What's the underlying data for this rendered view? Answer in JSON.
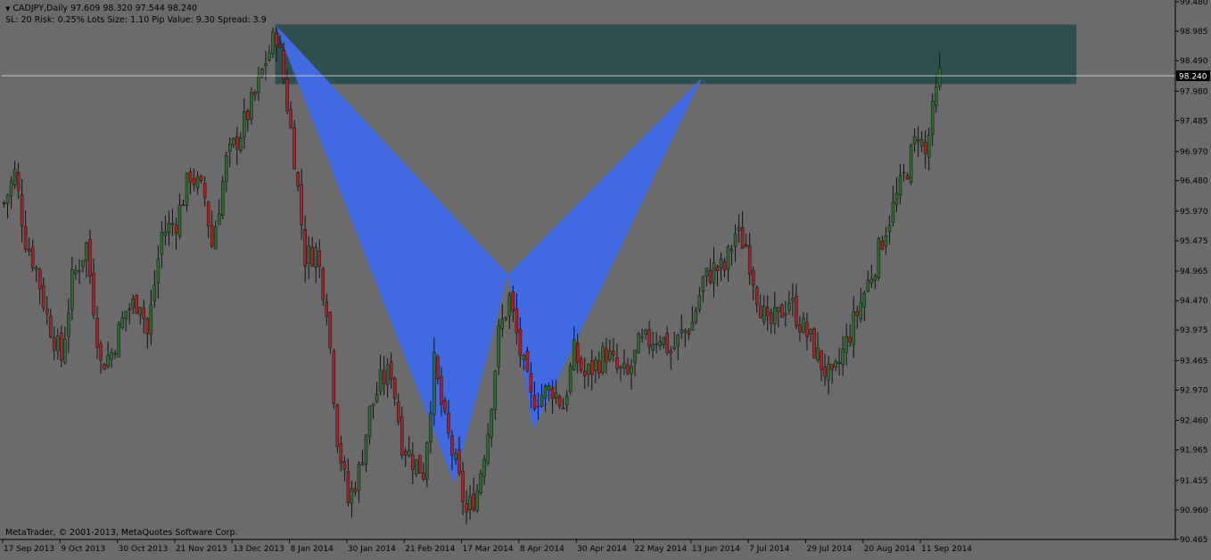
{
  "window": {
    "symbol_line": "CADJPY,Daily  97.609 98.320 97.544 98.240",
    "info_line": "SL: 20 Risk: 0.25%  Lots Size: 1.10 Pip Value: 9.30 Spread: 3.9",
    "copyright": "MetaTrader, © 2001-2013, MetaQuotes Software Corp."
  },
  "colors": {
    "background": "#6b6b6b",
    "axis": "#000000",
    "bull_candle": "#2e6b2e",
    "bear_candle": "#b02020",
    "pattern_fill": "#4169e1",
    "zone_fill": "#2f4f4f",
    "price_line": "#c0c0c0",
    "price_label_bg": "#000000",
    "price_label_text": "#ffffff"
  },
  "chart_data": {
    "type": "candlestick",
    "symbol": "CADJPY",
    "timeframe": "Daily",
    "ylim": [
      90.465,
      99.48
    ],
    "y_ticks": [
      "99.480",
      "98.985",
      "98.490",
      "97.980",
      "97.485",
      "96.970",
      "96.480",
      "95.970",
      "95.475",
      "94.965",
      "94.470",
      "93.975",
      "93.465",
      "92.970",
      "92.460",
      "91.965",
      "91.455",
      "90.960",
      "90.465"
    ],
    "x_tick_labels": [
      "17 Sep 2013",
      "9 Oct 2013",
      "30 Oct 2013",
      "21 Nov 2013",
      "13 Dec 2013",
      "8 Jan 2014",
      "30 Jan 2014",
      "21 Feb 2014",
      "17 Mar 2014",
      "8 Apr 2014",
      "30 Apr 2014",
      "22 May 2014",
      "13 Jun 2014",
      "7 Jul 2014",
      "29 Jul 2014",
      "20 Aug 2014",
      "11 Sep 2014"
    ],
    "last_price": "98.240",
    "close_path": [
      {
        "bar": 0,
        "price": 96.1
      },
      {
        "bar": 3,
        "price": 96.6
      },
      {
        "bar": 6,
        "price": 95.5
      },
      {
        "bar": 9,
        "price": 95.0
      },
      {
        "bar": 12,
        "price": 94.2
      },
      {
        "bar": 16,
        "price": 93.5
      },
      {
        "bar": 19,
        "price": 94.8
      },
      {
        "bar": 23,
        "price": 95.4
      },
      {
        "bar": 27,
        "price": 93.4
      },
      {
        "bar": 30,
        "price": 93.6
      },
      {
        "bar": 34,
        "price": 94.3
      },
      {
        "bar": 38,
        "price": 94.5
      },
      {
        "bar": 40,
        "price": 93.9
      },
      {
        "bar": 44,
        "price": 95.6
      },
      {
        "bar": 48,
        "price": 95.8
      },
      {
        "bar": 52,
        "price": 96.6
      },
      {
        "bar": 56,
        "price": 96.2
      },
      {
        "bar": 58,
        "price": 95.4
      },
      {
        "bar": 62,
        "price": 96.8
      },
      {
        "bar": 66,
        "price": 97.3
      },
      {
        "bar": 70,
        "price": 97.9
      },
      {
        "bar": 73,
        "price": 98.5
      },
      {
        "bar": 76,
        "price": 98.95
      },
      {
        "bar": 78,
        "price": 98.2
      },
      {
        "bar": 81,
        "price": 96.9
      },
      {
        "bar": 84,
        "price": 95.2
      },
      {
        "bar": 87,
        "price": 95.3
      },
      {
        "bar": 90,
        "price": 94.4
      },
      {
        "bar": 93,
        "price": 92.2
      },
      {
        "bar": 96,
        "price": 91.1
      },
      {
        "bar": 99,
        "price": 91.6
      },
      {
        "bar": 102,
        "price": 92.6
      },
      {
        "bar": 105,
        "price": 93.1
      },
      {
        "bar": 108,
        "price": 93.3
      },
      {
        "bar": 111,
        "price": 92.1
      },
      {
        "bar": 114,
        "price": 91.8
      },
      {
        "bar": 117,
        "price": 91.6
      },
      {
        "bar": 120,
        "price": 93.4
      },
      {
        "bar": 123,
        "price": 92.4
      },
      {
        "bar": 126,
        "price": 91.7
      },
      {
        "bar": 129,
        "price": 90.9
      },
      {
        "bar": 132,
        "price": 91.3
      },
      {
        "bar": 135,
        "price": 92.3
      },
      {
        "bar": 138,
        "price": 93.9
      },
      {
        "bar": 141,
        "price": 94.5
      },
      {
        "bar": 144,
        "price": 93.6
      },
      {
        "bar": 147,
        "price": 92.8
      },
      {
        "bar": 150,
        "price": 92.9
      },
      {
        "bar": 153,
        "price": 93.0
      },
      {
        "bar": 156,
        "price": 92.7
      },
      {
        "bar": 159,
        "price": 93.6
      },
      {
        "bar": 162,
        "price": 93.2
      },
      {
        "bar": 165,
        "price": 93.4
      },
      {
        "bar": 168,
        "price": 93.6
      },
      {
        "bar": 171,
        "price": 93.3
      },
      {
        "bar": 174,
        "price": 93.2
      },
      {
        "bar": 177,
        "price": 93.7
      },
      {
        "bar": 180,
        "price": 93.8
      },
      {
        "bar": 183,
        "price": 93.9
      },
      {
        "bar": 186,
        "price": 93.6
      },
      {
        "bar": 189,
        "price": 93.9
      },
      {
        "bar": 192,
        "price": 94.1
      },
      {
        "bar": 195,
        "price": 94.8
      },
      {
        "bar": 198,
        "price": 95.0
      },
      {
        "bar": 201,
        "price": 95.0
      },
      {
        "bar": 204,
        "price": 95.6
      },
      {
        "bar": 207,
        "price": 95.4
      },
      {
        "bar": 210,
        "price": 94.6
      },
      {
        "bar": 213,
        "price": 94.0
      },
      {
        "bar": 216,
        "price": 94.2
      },
      {
        "bar": 219,
        "price": 94.5
      },
      {
        "bar": 222,
        "price": 94.1
      },
      {
        "bar": 225,
        "price": 93.8
      },
      {
        "bar": 228,
        "price": 93.4
      },
      {
        "bar": 231,
        "price": 93.1
      },
      {
        "bar": 234,
        "price": 93.6
      },
      {
        "bar": 237,
        "price": 94.1
      },
      {
        "bar": 240,
        "price": 94.6
      },
      {
        "bar": 243,
        "price": 95.1
      },
      {
        "bar": 246,
        "price": 95.7
      },
      {
        "bar": 249,
        "price": 96.2
      },
      {
        "bar": 252,
        "price": 96.7
      },
      {
        "bar": 255,
        "price": 97.3
      },
      {
        "bar": 257,
        "price": 96.9
      },
      {
        "bar": 259,
        "price": 97.6
      },
      {
        "bar": 261,
        "price": 98.24
      }
    ],
    "zone": {
      "bar_start": 76,
      "bar_end": 300,
      "price_top": 99.1,
      "price_bottom": 98.1
    },
    "pattern": {
      "wing_left": [
        {
          "bar": 76,
          "price": 99.1
        },
        {
          "bar": 126,
          "price": 91.4
        },
        {
          "bar": 141,
          "price": 94.9
        }
      ],
      "wing_right": [
        {
          "bar": 141,
          "price": 94.9
        },
        {
          "bar": 148,
          "price": 92.3
        },
        {
          "bar": 195,
          "price": 98.2
        }
      ]
    }
  }
}
